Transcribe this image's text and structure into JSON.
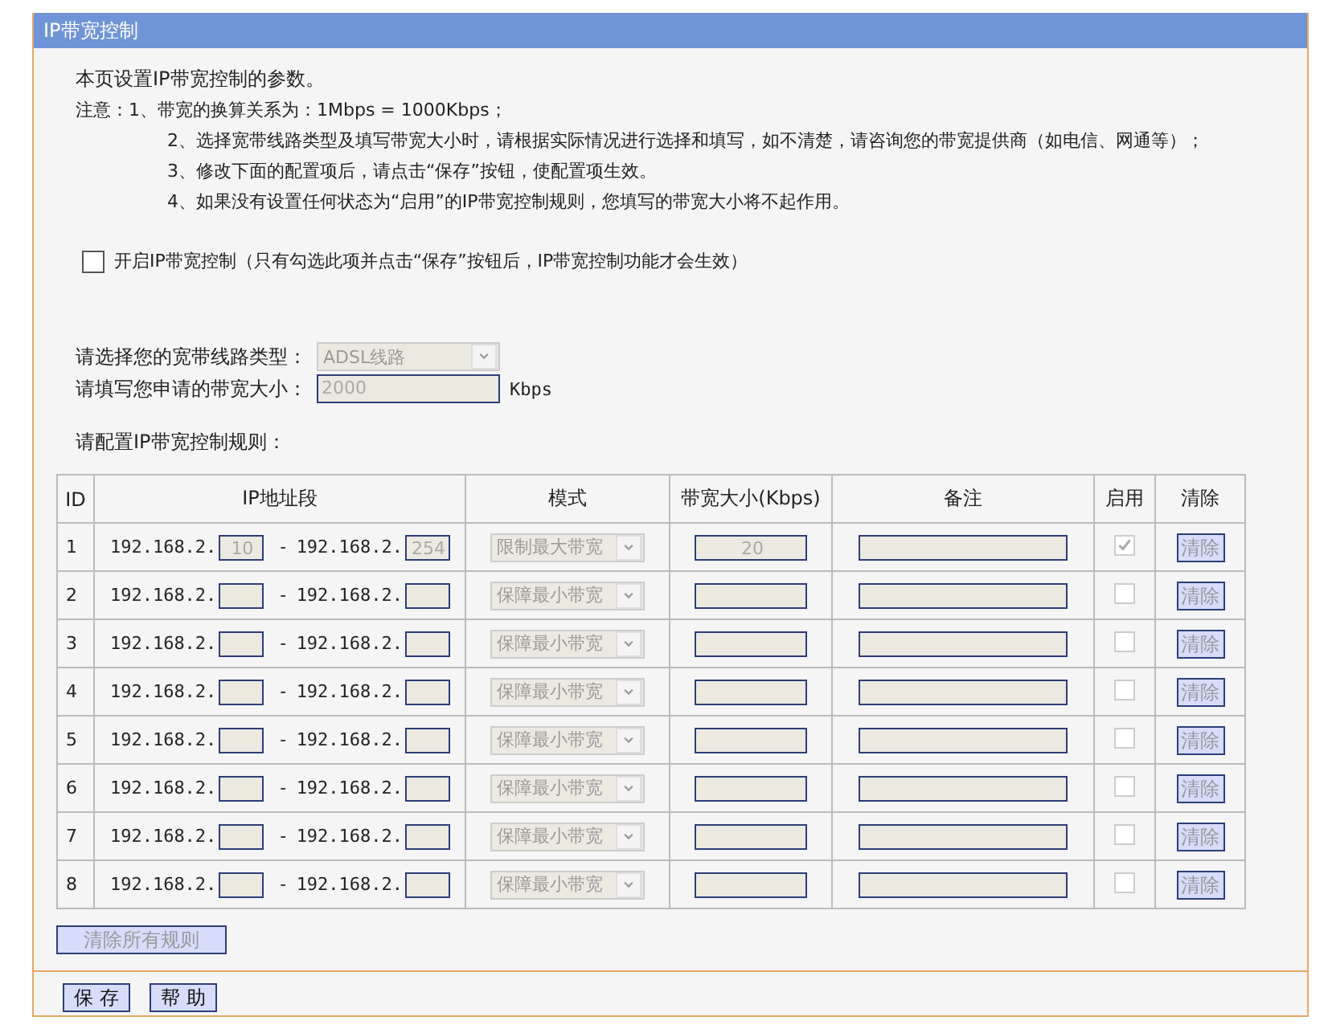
{
  "panel": {
    "title": "IP带宽控制"
  },
  "intro": "本页设置IP带宽控制的参数。",
  "notes_label": "注意：",
  "notes": [
    "1、带宽的换算关系为：1Mbps = 1000Kbps；",
    "2、选择宽带线路类型及填写带宽大小时，请根据实际情况进行选择和填写，如不清楚，请咨询您的带宽提供商（如电信、网通等）；",
    "3、修改下面的配置项后，请点击“保存”按钮，使配置项生效。",
    "4、如果没有设置任何状态为“启用”的IP带宽控制规则，您填写的带宽大小将不起作用。"
  ],
  "enable_control": {
    "label": "开启IP带宽控制（只有勾选此项并点击“保存”按钮后，IP带宽控制功能才会生效）",
    "checked": false
  },
  "line_type": {
    "label": "请选择您的宽带线路类型：",
    "value": "ADSL线路"
  },
  "bandwidth": {
    "label": "请填写您申请的带宽大小：",
    "value": "2000",
    "unit": "Kbps"
  },
  "rules_title": "请配置IP带宽控制规则：",
  "table": {
    "columns": [
      "ID",
      "IP地址段",
      "模式",
      "带宽大小(Kbps)",
      "备注",
      "启用",
      "清除"
    ],
    "rows": [
      {
        "id": "1",
        "start_prefix": "192.168.2.",
        "start": "10",
        "separator": "-",
        "end_prefix": "192.168.2.",
        "end": "254",
        "mode": "限制最大带宽",
        "bandwidth": "20",
        "enabled": true,
        "clear": "清除"
      },
      {
        "id": "2",
        "start_prefix": "192.168.2.",
        "separator": "-",
        "end_prefix": "192.168.2.",
        "mode": "保障最小带宽",
        "enabled": false,
        "clear": "清除"
      },
      {
        "id": "3",
        "start_prefix": "192.168.2.",
        "separator": "-",
        "end_prefix": "192.168.2.",
        "mode": "保障最小带宽",
        "enabled": false,
        "clear": "清除"
      },
      {
        "id": "4",
        "start_prefix": "192.168.2.",
        "separator": "-",
        "end_prefix": "192.168.2.",
        "mode": "保障最小带宽",
        "enabled": false,
        "clear": "清除"
      },
      {
        "id": "5",
        "start_prefix": "192.168.2.",
        "separator": "-",
        "end_prefix": "192.168.2.",
        "mode": "保障最小带宽",
        "enabled": false,
        "clear": "清除"
      },
      {
        "id": "6",
        "start_prefix": "192.168.2.",
        "separator": "-",
        "end_prefix": "192.168.2.",
        "mode": "保障最小带宽",
        "enabled": false,
        "clear": "清除"
      },
      {
        "id": "7",
        "start_prefix": "192.168.2.",
        "separator": "-",
        "end_prefix": "192.168.2.",
        "mode": "保障最小带宽",
        "enabled": false,
        "clear": "清除"
      },
      {
        "id": "8",
        "start_prefix": "192.168.2.",
        "separator": "-",
        "end_prefix": "192.168.2.",
        "mode": "保障最小带宽",
        "enabled": false,
        "clear": "清除"
      }
    ]
  },
  "clear_all_button": "清除所有规则",
  "buttons": [
    "保 存",
    "帮 助"
  ]
}
